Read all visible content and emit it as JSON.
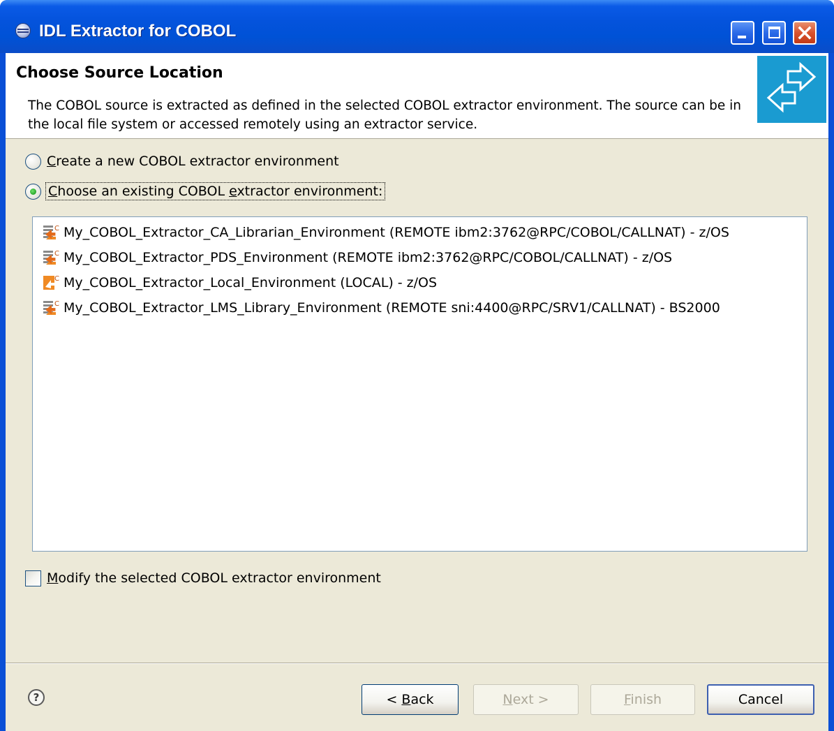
{
  "window": {
    "title": "IDL Extractor for COBOL"
  },
  "header": {
    "title": "Choose Source Location",
    "description": "The COBOL source is extracted as defined in the selected COBOL extractor environment. The source can be in the local file system or accessed remotely using an extractor service."
  },
  "options": {
    "create_new": {
      "mnemonic": "C",
      "rest": "reate a new COBOL extractor environment",
      "selected": false
    },
    "choose_existing": {
      "mnemonic": "C",
      "part1": "hoose an existing COBOL ",
      "mnemonic2": "e",
      "part2": "xtractor environment:",
      "selected": true
    }
  },
  "environments": [
    {
      "label": "My_COBOL_Extractor_CA_Librarian_Environment (REMOTE ibm2:3762@RPC/COBOL/CALLNAT) - z/OS",
      "icon": "remote-extractor-icon"
    },
    {
      "label": "My_COBOL_Extractor_PDS_Environment (REMOTE ibm2:3762@RPC/COBOL/CALLNAT) - z/OS",
      "icon": "remote-extractor-icon"
    },
    {
      "label": "My_COBOL_Extractor_Local_Environment (LOCAL) - z/OS",
      "icon": "local-extractor-icon"
    },
    {
      "label": "My_COBOL_Extractor_LMS_Library_Environment (REMOTE sni:4400@RPC/SRV1/CALLNAT) - BS2000",
      "icon": "remote-extractor-icon"
    }
  ],
  "modify": {
    "mnemonic": "M",
    "rest": "odify the selected COBOL extractor environment",
    "checked": false
  },
  "buttons": {
    "back_prefix": "< ",
    "back_mnemonic": "B",
    "back_rest": "ack",
    "next_mnemonic": "N",
    "next_rest": "ext >",
    "finish_mnemonic": "F",
    "finish_rest": "inish",
    "cancel": "Cancel"
  },
  "help": {
    "glyph": "?"
  },
  "colors": {
    "titlebar": "#0052d6",
    "client": "#ece9d8",
    "banner": "#1a9bd1",
    "close_button": "#d8522e"
  }
}
